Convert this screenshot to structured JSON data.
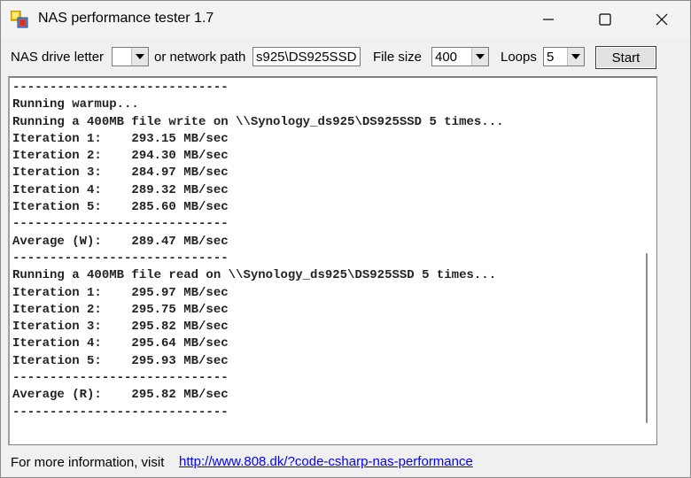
{
  "window": {
    "title": "NAS performance tester 1.7"
  },
  "toolbar": {
    "drive_letter_label": "NAS drive letter",
    "drive_letter_value": "",
    "network_path_label": "or network path",
    "network_path_value": "s925\\DS925SSD",
    "file_size_label": "File size",
    "file_size_value": "400",
    "loops_label": "Loops",
    "loops_value": "5",
    "start_label": "Start"
  },
  "log": {
    "lines": [
      "-----------------------------",
      "Running warmup...",
      "Running a 400MB file write on \\\\Synology_ds925\\DS925SSD 5 times...",
      "Iteration 1:    293.15 MB/sec",
      "Iteration 2:    294.30 MB/sec",
      "Iteration 3:    284.97 MB/sec",
      "Iteration 4:    289.32 MB/sec",
      "Iteration 5:    285.60 MB/sec",
      "-----------------------------",
      "Average (W):    289.47 MB/sec",
      "-----------------------------",
      "Running a 400MB file read on \\\\Synology_ds925\\DS925SSD 5 times...",
      "Iteration 1:    295.97 MB/sec",
      "Iteration 2:    295.75 MB/sec",
      "Iteration 3:    295.82 MB/sec",
      "Iteration 4:    295.64 MB/sec",
      "Iteration 5:    295.93 MB/sec",
      "-----------------------------",
      "Average (R):    295.82 MB/sec",
      "-----------------------------"
    ]
  },
  "footer": {
    "info_label": "For more information, visit",
    "link_text": "http://www.808.dk/?code-csharp-nas-performance"
  }
}
